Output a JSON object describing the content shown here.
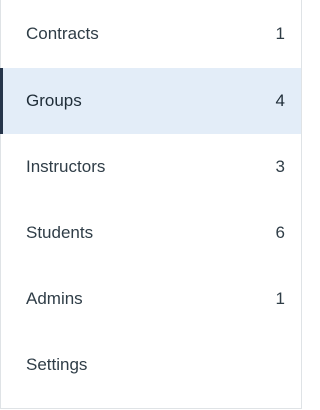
{
  "sidebar": {
    "items": [
      {
        "label": "Contracts",
        "count": "1"
      },
      {
        "label": "Groups",
        "count": "4",
        "active": true
      },
      {
        "label": "Instructors",
        "count": "3"
      },
      {
        "label": "Students",
        "count": "6"
      },
      {
        "label": "Admins",
        "count": "1"
      },
      {
        "label": "Settings",
        "count": ""
      }
    ],
    "active_index": 1
  },
  "colors": {
    "active_background": "#e3edf8",
    "active_indicator": "#26354a",
    "text": "#2f3d47",
    "border": "#dfe3e6"
  }
}
